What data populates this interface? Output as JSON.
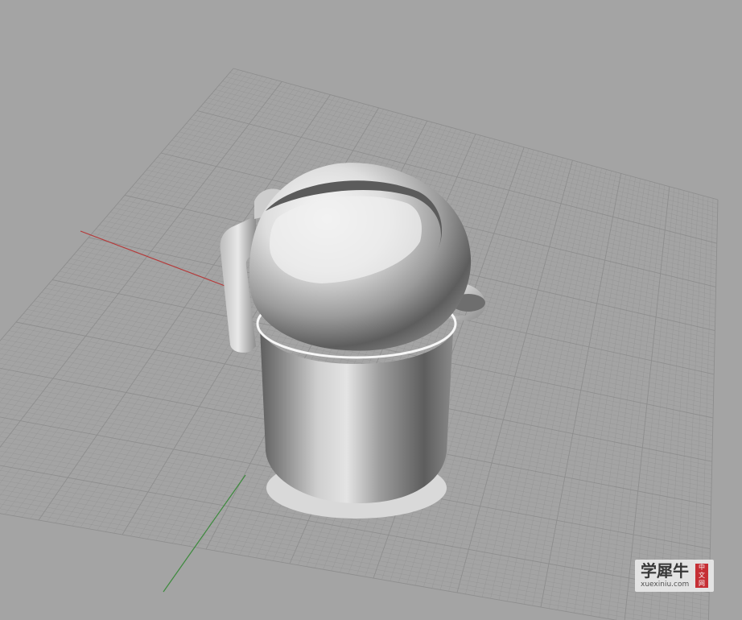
{
  "viewport": {
    "background": "#a4a4a4",
    "grid_color": "#8c8c8c",
    "x_axis_color": "#b53a3a",
    "y_axis_color": "#3d8a3d"
  },
  "model": {
    "name": "kettle",
    "parts": [
      "body",
      "lid",
      "handle",
      "spout",
      "base"
    ]
  },
  "watermark": {
    "cn_text": "学犀牛",
    "url": "xuexiniu.com",
    "seal_chars": [
      "中",
      "文",
      "网"
    ]
  }
}
